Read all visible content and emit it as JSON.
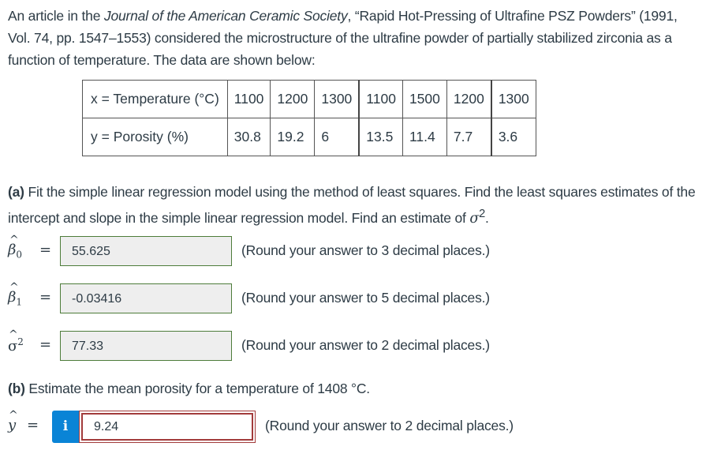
{
  "intro": {
    "prefix": "An article in the ",
    "journal": "Journal of the American Ceramic Society",
    "suffix": ", “Rapid Hot-Pressing of Ultrafine PSZ Powders” (1991, Vol. 74, pp. 1547–1553) considered the microstructure of the ultrafine powder of partially stabilized zirconia as a function of temperature. The data are shown below:"
  },
  "table": {
    "x_label": "x = Temperature (°C)",
    "y_label": "y = Porosity (%)",
    "x_values": [
      "1100",
      "1200",
      "1300",
      "1100",
      "1500",
      "1200",
      "1300"
    ],
    "y_values": [
      "30.8",
      "19.2",
      "6",
      "13.5",
      "11.4",
      "7.7",
      "3.6"
    ]
  },
  "part_a": {
    "label": "(a)",
    "text": " Fit the simple linear regression model using the method of least squares. Find the least squares estimates of the intercept and slope in the simple linear regression model. Find an estimate of ",
    "sigma": "σ",
    "sup": "2",
    "end": "."
  },
  "answers": [
    {
      "symbol": "β",
      "sub": "0",
      "equals": "=",
      "value": "55.625",
      "note": "(Round your answer to 3 decimal places.)"
    },
    {
      "symbol": "β",
      "sub": "1",
      "equals": "=",
      "value": "-0.03416",
      "note": "(Round your answer to 5 decimal places.)"
    },
    {
      "symbol": "σ",
      "sup": "2",
      "equals": "=",
      "value": "77.33",
      "note": "(Round your answer to 2 decimal places.)"
    }
  ],
  "part_b": {
    "label": "(b)",
    "text": " Estimate the mean porosity for a temperature of 1408 °C.",
    "symbol": "y",
    "equals": "=",
    "info_icon": "i",
    "value": "9.24",
    "note": "(Round your answer to 2 decimal places.)"
  }
}
